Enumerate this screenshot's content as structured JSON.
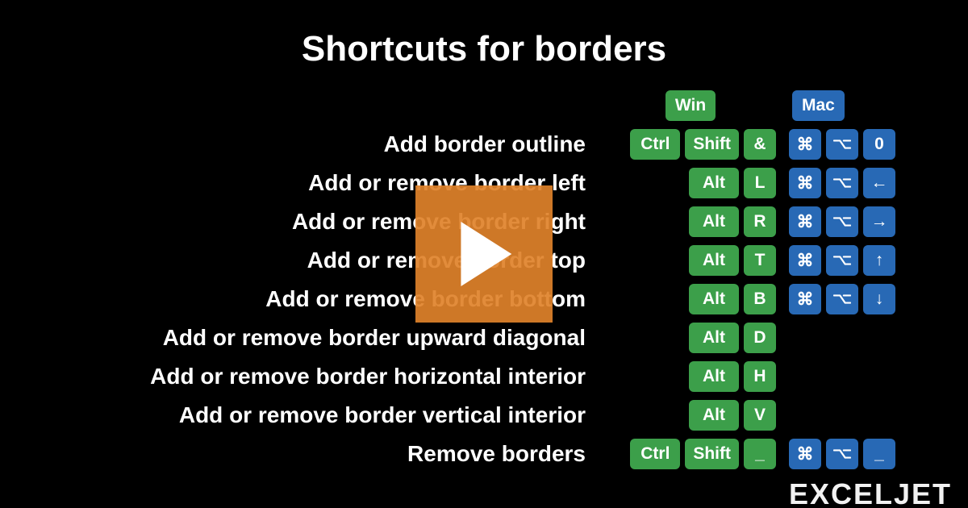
{
  "title": "Shortcuts for borders",
  "headers": {
    "win": "Win",
    "mac": "Mac"
  },
  "rows": [
    {
      "desc": "Add border outline",
      "win": [
        "Ctrl",
        "Shift",
        "&"
      ],
      "mac": [
        "cmd",
        "opt",
        "0"
      ]
    },
    {
      "desc": "Add or remove border left",
      "win": [
        "Alt",
        "L"
      ],
      "mac": [
        "cmd",
        "opt",
        "←"
      ]
    },
    {
      "desc": "Add or remove border right",
      "win": [
        "Alt",
        "R"
      ],
      "mac": [
        "cmd",
        "opt",
        "→"
      ]
    },
    {
      "desc": "Add or remove border top",
      "win": [
        "Alt",
        "T"
      ],
      "mac": [
        "cmd",
        "opt",
        "↑"
      ]
    },
    {
      "desc": "Add or remove border bottom",
      "win": [
        "Alt",
        "B"
      ],
      "mac": [
        "cmd",
        "opt",
        "↓"
      ]
    },
    {
      "desc": "Add or remove border upward diagonal",
      "win": [
        "Alt",
        "D"
      ],
      "mac": []
    },
    {
      "desc": "Add or remove border horizontal interior",
      "win": [
        "Alt",
        "H"
      ],
      "mac": []
    },
    {
      "desc": "Add or remove border vertical interior",
      "win": [
        "Alt",
        "V"
      ],
      "mac": []
    },
    {
      "desc": "Remove borders",
      "win": [
        "Ctrl",
        "Shift",
        "_"
      ],
      "mac": [
        "cmd",
        "opt",
        "_"
      ]
    }
  ],
  "brand": "EXCELJET"
}
